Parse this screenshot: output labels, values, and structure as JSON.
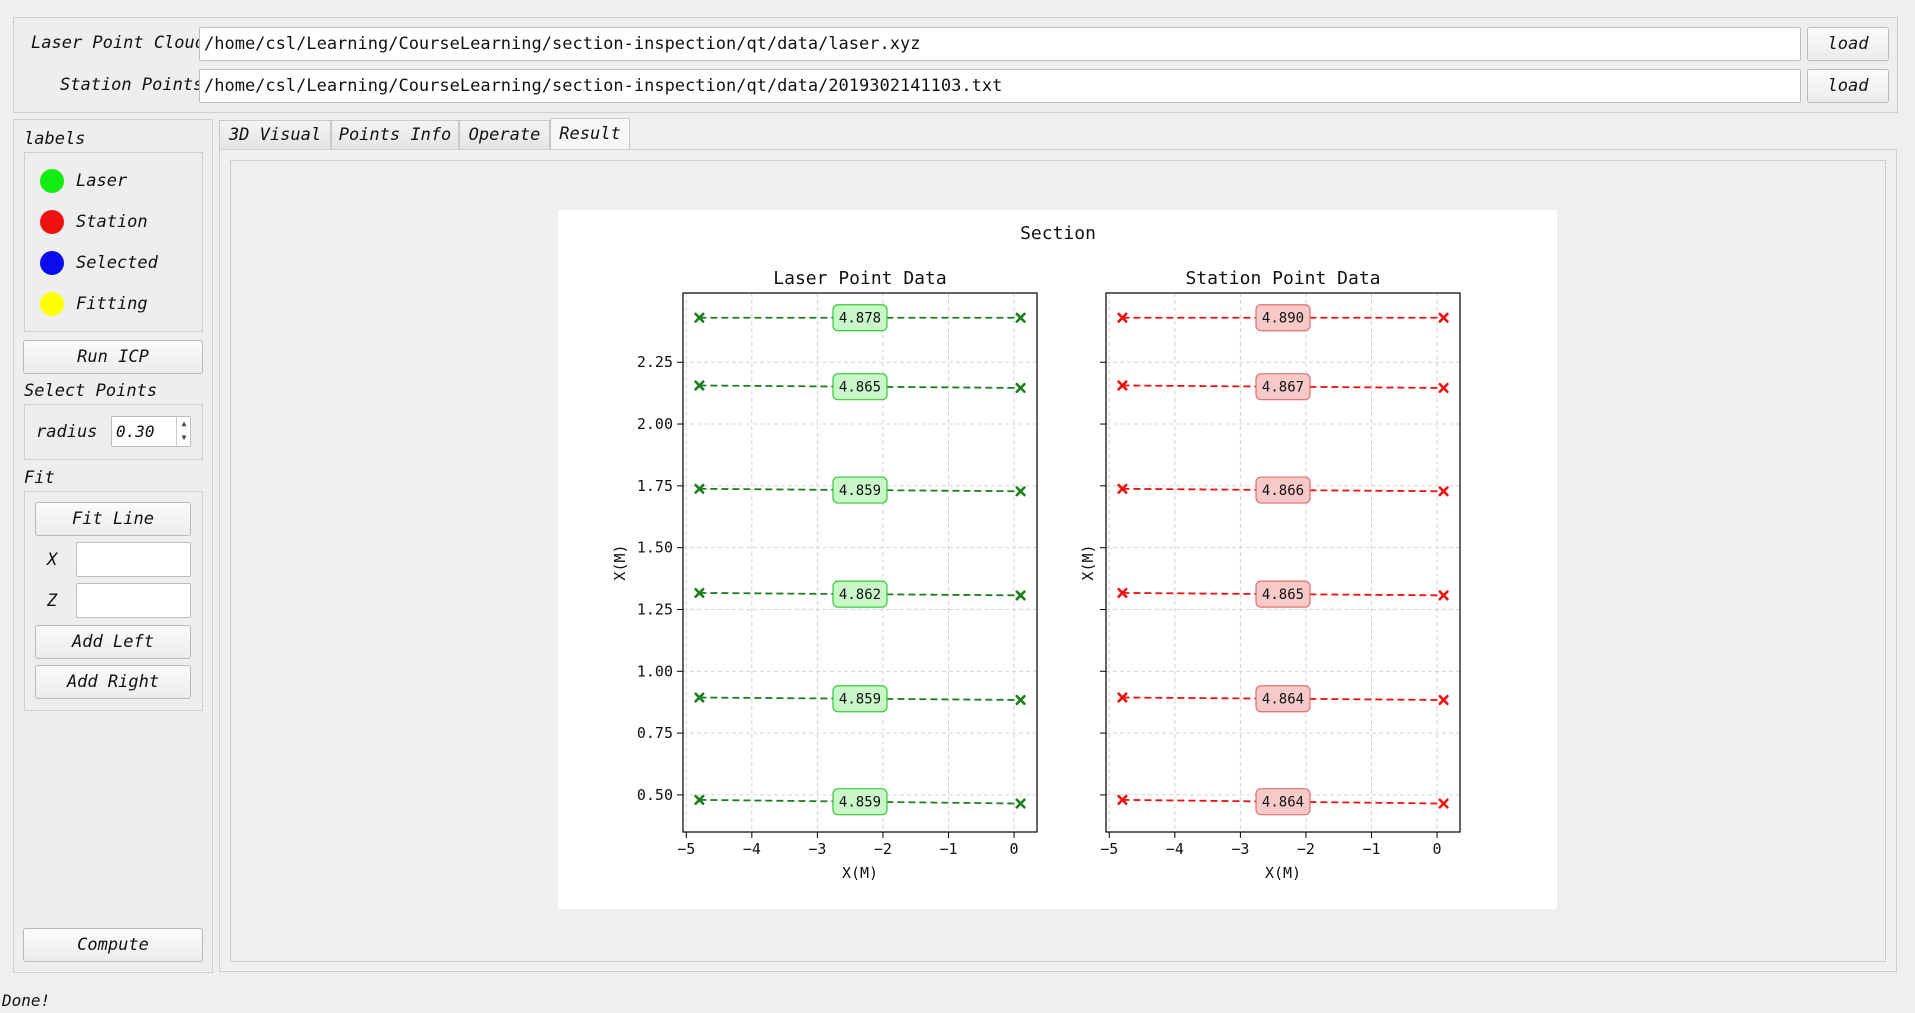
{
  "files": {
    "laser_label": "Laser Point Cloud",
    "laser_path": "/home/csl/Learning/CourseLearning/section-inspection/qt/data/laser.xyz",
    "station_label": "Station Points",
    "station_path": "/home/csl/Learning/CourseLearning/section-inspection/qt/data/2019302141103.txt",
    "load_label": "load"
  },
  "sidebar": {
    "labels_title": "labels",
    "legend": [
      {
        "label": "Laser",
        "color": "#12ee12"
      },
      {
        "label": "Station",
        "color": "#ee1111"
      },
      {
        "label": "Selected",
        "color": "#0b0bee"
      },
      {
        "label": "Fitting",
        "color": "#ffff00"
      }
    ],
    "run_icp": "Run ICP",
    "select_points_title": "Select Points",
    "radius_label": "radius",
    "radius_value": "0.30",
    "fit_title": "Fit",
    "fit_line": "Fit Line",
    "x_label": "X",
    "z_label": "Z",
    "x_value": "",
    "z_value": "",
    "add_left": "Add Left",
    "add_right": "Add Right",
    "compute": "Compute"
  },
  "tabs": [
    "3D Visual",
    "Points Info",
    "Operate",
    "Result"
  ],
  "active_tab": "Result",
  "status": "Done!",
  "chart_data": {
    "type": "line",
    "title": "Section",
    "subplots": [
      {
        "title": "Laser Point Data",
        "xlabel": "X(M)",
        "ylabel": "X(M)",
        "color": "#1b7f1b",
        "label_bg": "#c9f7c9",
        "label_border": "#33cc33",
        "xlim": [
          -5.05,
          0.35
        ],
        "ylim": [
          0.35,
          2.53
        ],
        "xticks": [
          -5,
          -4,
          -3,
          -2,
          -1,
          0
        ],
        "yticks": [
          0.5,
          0.75,
          1.0,
          1.25,
          1.5,
          1.75,
          2.0,
          2.25
        ],
        "ytick_labels": [
          "0.50",
          "0.75",
          "1.00",
          "1.25",
          "1.50",
          "1.75",
          "2.00",
          "2.25"
        ],
        "lines": [
          {
            "x": [
              -4.8,
              0.1
            ],
            "y": [
              2.43,
              2.43
            ],
            "label": "4.878"
          },
          {
            "x": [
              -4.8,
              0.1
            ],
            "y": [
              2.156,
              2.146
            ],
            "label": "4.865"
          },
          {
            "x": [
              -4.8,
              0.1
            ],
            "y": [
              1.738,
              1.728
            ],
            "label": "4.859"
          },
          {
            "x": [
              -4.8,
              0.1
            ],
            "y": [
              1.317,
              1.307
            ],
            "label": "4.862"
          },
          {
            "x": [
              -4.8,
              0.1
            ],
            "y": [
              0.894,
              0.884
            ],
            "label": "4.859"
          },
          {
            "x": [
              -4.8,
              0.1
            ],
            "y": [
              0.48,
              0.465
            ],
            "label": "4.859"
          }
        ]
      },
      {
        "title": "Station Point Data",
        "xlabel": "X(M)",
        "ylabel": "X(M)",
        "color": "#ee1111",
        "label_bg": "#f7c9c9",
        "label_border": "#e07070",
        "xlim": [
          -5.05,
          0.35
        ],
        "ylim": [
          0.35,
          2.53
        ],
        "xticks": [
          -5,
          -4,
          -3,
          -2,
          -1,
          0
        ],
        "yticks": [
          0.5,
          0.75,
          1.0,
          1.25,
          1.5,
          1.75,
          2.0,
          2.25
        ],
        "ytick_labels": [],
        "lines": [
          {
            "x": [
              -4.8,
              0.1
            ],
            "y": [
              2.43,
              2.43
            ],
            "label": "4.890"
          },
          {
            "x": [
              -4.8,
              0.1
            ],
            "y": [
              2.156,
              2.146
            ],
            "label": "4.867"
          },
          {
            "x": [
              -4.8,
              0.1
            ],
            "y": [
              1.738,
              1.728
            ],
            "label": "4.866"
          },
          {
            "x": [
              -4.8,
              0.1
            ],
            "y": [
              1.317,
              1.307
            ],
            "label": "4.865"
          },
          {
            "x": [
              -4.8,
              0.1
            ],
            "y": [
              0.894,
              0.884
            ],
            "label": "4.864"
          },
          {
            "x": [
              -4.8,
              0.1
            ],
            "y": [
              0.48,
              0.465
            ],
            "label": "4.864"
          }
        ]
      }
    ]
  }
}
